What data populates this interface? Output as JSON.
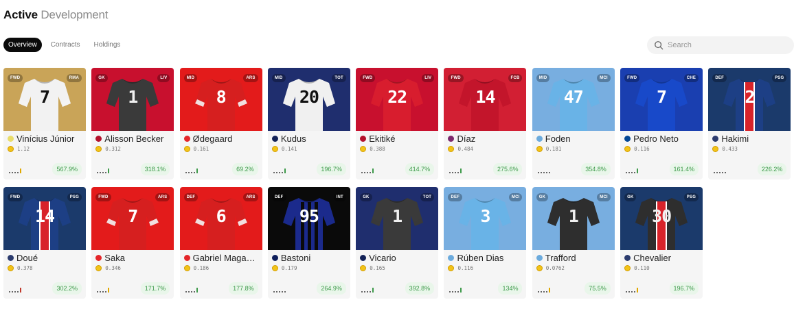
{
  "header": {
    "title_primary": "Active",
    "title_secondary": "Development"
  },
  "tabs": [
    {
      "label": "Overview",
      "active": true
    },
    {
      "label": "Contracts",
      "active": false
    },
    {
      "label": "Holdings",
      "active": false
    }
  ],
  "search": {
    "placeholder": "Search",
    "icon": "search-icon"
  },
  "players": [
    {
      "name": "Vinícius Júnior",
      "position": "FWD",
      "club": "RMA",
      "number": "7",
      "price": "1.12",
      "change": "567.9%",
      "bg": "#c9a458",
      "shirt": "#f2f2f2",
      "num_color": "#111",
      "dot": "#e9dd6a",
      "trend": "gold"
    },
    {
      "name": "Alisson Becker",
      "position": "GK",
      "club": "LIV",
      "number": "1",
      "price": "0.312",
      "change": "318.1%",
      "bg": "#c8102e",
      "shirt": "#3a3a3a",
      "num_color": "#f0f0f0",
      "dot": "#b3122c",
      "trend": "green"
    },
    {
      "name": "Ødegaard",
      "position": "MID",
      "club": "ARS",
      "number": "8",
      "price": "0.161",
      "change": "69.2%",
      "bg": "#e31b1b",
      "shirt": "#d61f1f",
      "num_color": "#ffffff",
      "dot": "#e4262a",
      "trend": "green"
    },
    {
      "name": "Kudus",
      "position": "MID",
      "club": "TOT",
      "number": "20",
      "price": "0.141",
      "change": "196.7%",
      "bg": "#1f2e6e",
      "shirt": "#f0f0f0",
      "num_color": "#111",
      "dot": "#132257",
      "trend": "green"
    },
    {
      "name": "Ekitiké",
      "position": "FWD",
      "club": "LIV",
      "number": "22",
      "price": "0.388",
      "change": "414.7%",
      "bg": "#c8102e",
      "shirt": "#d81d2e",
      "num_color": "#ffffff",
      "dot": "#b3122c",
      "trend": "green"
    },
    {
      "name": "Díaz",
      "position": "FWD",
      "club": "FCB",
      "number": "14",
      "price": "0.484",
      "change": "275.6%",
      "bg": "#d21f33",
      "shirt": "#c3152b",
      "num_color": "#ffffff",
      "dot": "#7c2a6d",
      "trend": "green"
    },
    {
      "name": "Foden",
      "position": "MID",
      "club": "MCI",
      "number": "47",
      "price": "0.181",
      "change": "354.8%",
      "bg": "#78aee0",
      "shirt": "#69b3e7",
      "num_color": "#ffffff",
      "dot": "#6cabdd",
      "trend": "none"
    },
    {
      "name": "Pedro Neto",
      "position": "FWD",
      "club": "CHE",
      "number": "7",
      "price": "0.116",
      "change": "161.4%",
      "bg": "#1a3fb0",
      "shirt": "#1849c9",
      "num_color": "#ffffff",
      "dot": "#034694",
      "trend": "green"
    },
    {
      "name": "Hakimi",
      "position": "DEF",
      "club": "PSG",
      "number": "2",
      "price": "0.433",
      "change": "226.2%",
      "bg": "#1b3a6b",
      "shirt": "#1d3f85",
      "num_color": "#ffffff",
      "dot": "#2c3c6e",
      "trend": "none"
    },
    {
      "name": "Doué",
      "position": "FWD",
      "club": "PSG",
      "number": "14",
      "price": "0.378",
      "change": "302.2%",
      "bg": "#1b3a6b",
      "shirt": "#1d3f85",
      "num_color": "#ffffff",
      "dot": "#2c3c6e",
      "trend": "red"
    },
    {
      "name": "Saka",
      "position": "FWD",
      "club": "ARS",
      "number": "7",
      "price": "0.346",
      "change": "171.7%",
      "bg": "#e31b1b",
      "shirt": "#d61f1f",
      "num_color": "#ffffff",
      "dot": "#e4262a",
      "trend": "gold"
    },
    {
      "name": "Gabriel Maga…",
      "position": "DEF",
      "club": "ARS",
      "number": "6",
      "price": "0.186",
      "change": "177.8%",
      "bg": "#e31b1b",
      "shirt": "#d61f1f",
      "num_color": "#ffffff",
      "dot": "#e4262a",
      "trend": "green"
    },
    {
      "name": "Bastoni",
      "position": "DEF",
      "club": "INT",
      "number": "95",
      "price": "0.179",
      "change": "264.9%",
      "bg": "#0a0a0a",
      "shirt": "#1b2a8c",
      "num_color": "#ffffff",
      "dot": "#0f1f5c",
      "trend": "none"
    },
    {
      "name": "Vicario",
      "position": "GK",
      "club": "TOT",
      "number": "1",
      "price": "0.165",
      "change": "392.8%",
      "bg": "#1f2e6e",
      "shirt": "#3a3a3a",
      "num_color": "#f0f0f0",
      "dot": "#132257",
      "trend": "green"
    },
    {
      "name": "Rúben Dias",
      "position": "DEF",
      "club": "MCI",
      "number": "3",
      "price": "0.116",
      "change": "134%",
      "bg": "#78aee0",
      "shirt": "#69b3e7",
      "num_color": "#ffffff",
      "dot": "#6cabdd",
      "trend": "green"
    },
    {
      "name": "Trafford",
      "position": "GK",
      "club": "MCI",
      "number": "1",
      "price": "0.0762",
      "change": "75.5%",
      "bg": "#78aee0",
      "shirt": "#2e2e2e",
      "num_color": "#f0f0f0",
      "dot": "#6cabdd",
      "trend": "gold"
    },
    {
      "name": "Chevalier",
      "position": "GK",
      "club": "PSG",
      "number": "30",
      "price": "0.110",
      "change": "196.7%",
      "bg": "#1b3a6b",
      "shirt": "#2e2e2e",
      "num_color": "#f0f0f0",
      "dot": "#2c3c6e",
      "trend": "gold"
    }
  ]
}
